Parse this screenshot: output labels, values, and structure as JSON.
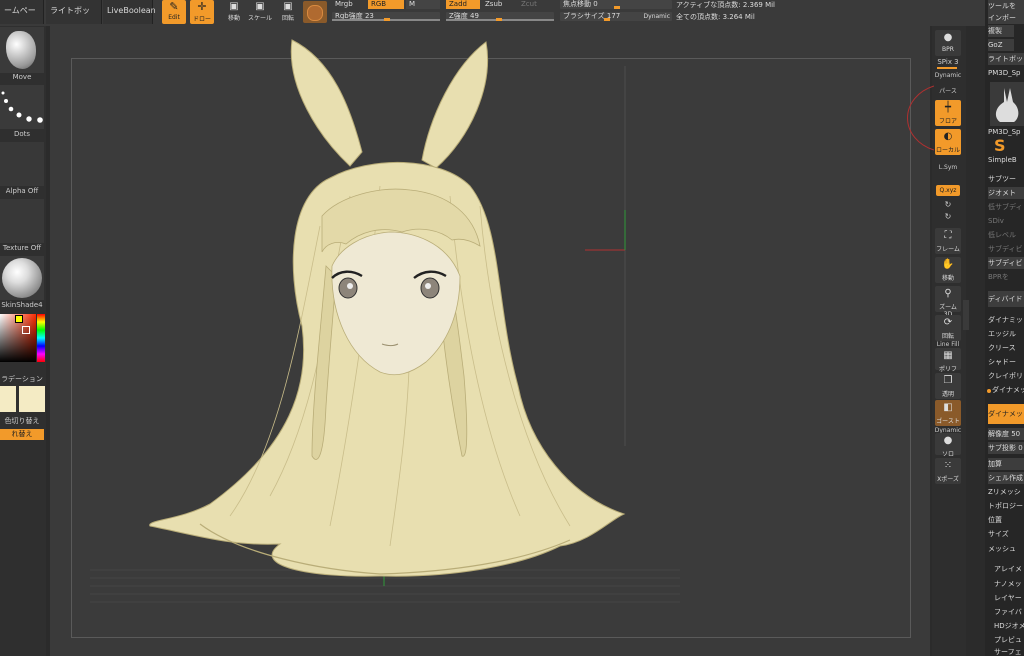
{
  "top_tabs": [
    "ームページ",
    "ライトボックス",
    "LiveBoolean"
  ],
  "top_tools": {
    "edit": "Edit",
    "draw": "ドロー",
    "move": "移動",
    "scale": "スケール",
    "rotate": "回転"
  },
  "modes": {
    "mrgb": "Mrgb",
    "rgb": "RGB",
    "m": "M",
    "zadd": "Zadd",
    "zsub": "Zsub",
    "zcut": "Zcut"
  },
  "sliders": {
    "rgb_intensity": "Rgb強度 23",
    "z_intensity": "Z強度 49",
    "focal_shift": "焦点移動 0",
    "brush_size": "ブラシサイズ 177",
    "dynamic": "Dynamic"
  },
  "stats": {
    "active_points": "アクティブな頂点数: 2.369 Mil",
    "total_points": "全ての頂点数: 3.264 Mil"
  },
  "left_tray": {
    "brush": "Move",
    "stroke": "Dots",
    "alpha": "Alpha Off",
    "texture": "Texture Off",
    "material": "SkinShade4",
    "gradation": "ラデーション",
    "switch_color": "色切り替え",
    "swap": "れ替え"
  },
  "shelf": {
    "bpr": "BPR",
    "spix": "SPix 3",
    "dynamic": "Dynamic",
    "perspective": "パース",
    "floor": "フロア",
    "local": "ローカル",
    "lsym": "L.Sym",
    "xyz": "Q.xyz",
    "frame": "フレーム",
    "move": "移動",
    "zoom3d": "ズーム3D",
    "rotate": "回転",
    "linefill": "Line Fill",
    "polyf": "ポリフ",
    "transp": "透明",
    "ghost": "ゴースト",
    "solo": "ソロ",
    "xpose": "Xポーズ"
  },
  "palette": {
    "items": [
      "ツールを",
      "インポー",
      "複製",
      "GoZ",
      "ライトボッ",
      "PM3D_Sp"
    ],
    "thumb_label1": "PM3D_Sp",
    "thumb_label2": "SimpleB",
    "subtool": "サブツー",
    "geometry": "ジオメト",
    "geo_items": [
      "低サブディ",
      "SDiv",
      "低レベル",
      "サブディビ",
      "サブディビ",
      "BPRを",
      "ディバイド",
      "ダイナミッ",
      "エッジル",
      "クリース",
      "シャドー",
      "クレイポリ"
    ],
    "dynamesh_header": "ダイナメッ",
    "dynamesh_button": "ダイナメッ",
    "resolution": "解像度 50",
    "sub_projection": "サブ投影 0",
    "dyn_items": [
      "加算",
      "シェル作成",
      "Zリメッシ",
      "トポロジー",
      "位置",
      "サイズ",
      "メッシュ"
    ],
    "bottom_items": [
      "アレイメ",
      "ナノメッ",
      "レイヤー",
      "ファイバ",
      "HDジオメ",
      "プレビュ",
      "サーフェ"
    ]
  },
  "colors": {
    "accent": "#f29a2a",
    "model": "#e8dfb0",
    "model_shadow": "#b9ad78"
  }
}
